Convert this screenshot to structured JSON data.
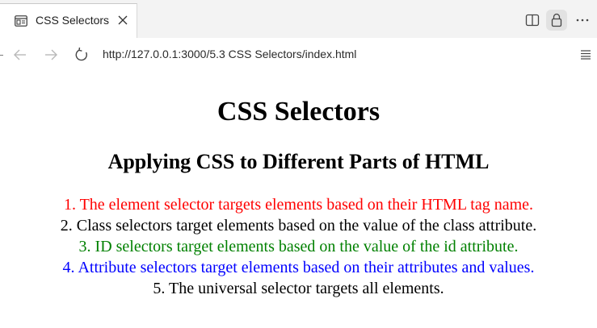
{
  "browser": {
    "tab": {
      "title": "CSS Selectors",
      "favicon": "page-icon",
      "close_icon": "close-icon"
    },
    "window_controls": [
      "split-view-icon",
      "lock-icon",
      "more-icon"
    ],
    "nav": {
      "back_icon": "back-arrow-icon",
      "forward_icon": "forward-arrow-icon",
      "reload_icon": "reload-icon"
    },
    "url": "http://127.0.0.1:3000/5.3 CSS Selectors/index.html",
    "menu_icon": "menu-icon"
  },
  "page": {
    "title": "CSS Selectors",
    "subtitle": "Applying CSS to Different Parts of HTML",
    "items": [
      {
        "text": "1. The element selector targets elements based on their HTML tag name.",
        "color": "#ff0000"
      },
      {
        "text": "2. Class selectors target elements based on the value of the class attribute.",
        "color": "#000000"
      },
      {
        "text": "3. ID selectors target elements based on the value of the id attribute.",
        "color": "#008000"
      },
      {
        "text": "4. Attribute selectors target elements based on their attributes and values.",
        "color": "#0000ff"
      },
      {
        "text": "5. The universal selector targets all elements.",
        "color": "#000000"
      }
    ]
  }
}
